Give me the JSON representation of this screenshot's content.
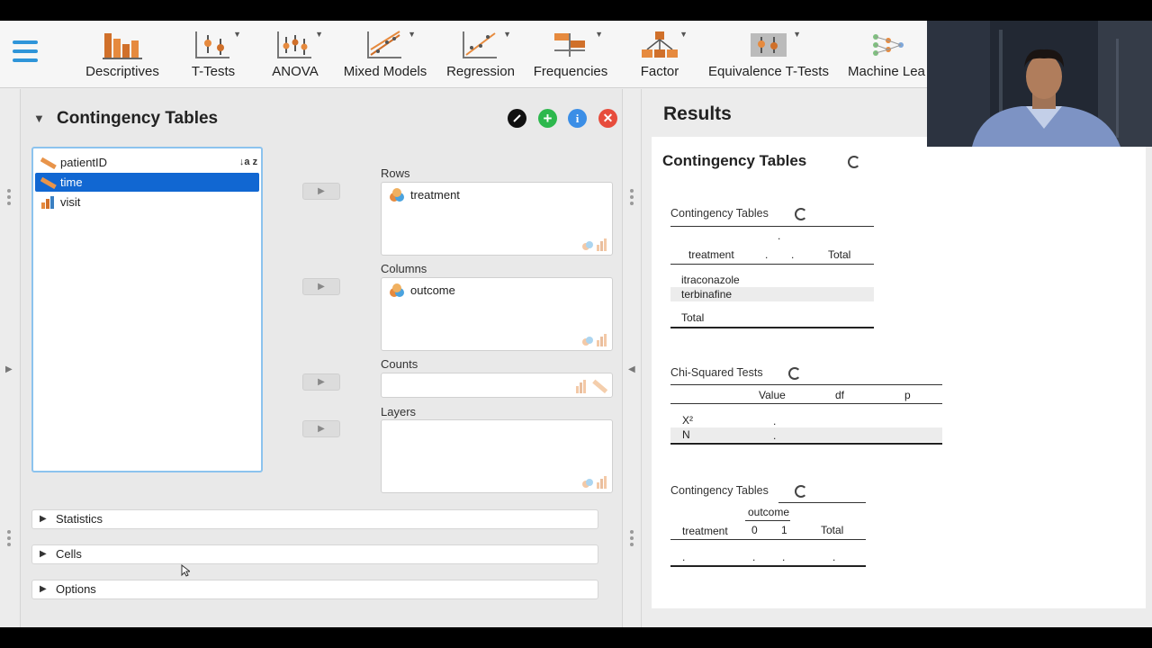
{
  "toolbar": {
    "modules": [
      {
        "label": "Descriptives"
      },
      {
        "label": "T-Tests"
      },
      {
        "label": "ANOVA"
      },
      {
        "label": "Mixed Models"
      },
      {
        "label": "Regression"
      },
      {
        "label": "Frequencies"
      },
      {
        "label": "Factor"
      },
      {
        "label": "Equivalence T-Tests"
      },
      {
        "label": "Machine Lea"
      }
    ]
  },
  "analysis": {
    "title": "Contingency Tables",
    "variables": [
      {
        "name": "patientID",
        "type": "nominal-text"
      },
      {
        "name": "time",
        "type": "nominal-text",
        "selected": true
      },
      {
        "name": "visit",
        "type": "scale"
      }
    ],
    "sort_label": "↓a z",
    "rows_label": "Rows",
    "rows_item": "treatment",
    "columns_label": "Columns",
    "columns_item": "outcome",
    "counts_label": "Counts",
    "layers_label": "Layers",
    "sections": [
      {
        "label": "Statistics"
      },
      {
        "label": "Cells"
      },
      {
        "label": "Options"
      }
    ]
  },
  "results": {
    "heading": "Results",
    "title": "Contingency Tables",
    "table1": {
      "title": "Contingency Tables",
      "top_dot": ".",
      "headers": [
        "treatment",
        ".",
        ".",
        "Total"
      ],
      "rows": [
        "itraconazole",
        "terbinafine",
        "Total"
      ]
    },
    "table2": {
      "title": "Chi-Squared Tests",
      "headers": [
        "Value",
        "df",
        "p"
      ],
      "rows": [
        {
          "label": "X²",
          "value": "."
        },
        {
          "label": "N",
          "value": "."
        }
      ]
    },
    "table3": {
      "title": "Contingency Tables",
      "group_header": "outcome",
      "headers": [
        "treatment",
        "0",
        "1",
        "Total"
      ],
      "row": [
        ".",
        ".",
        ".",
        "."
      ]
    }
  },
  "colors": {
    "accent": "#2f95d9",
    "selected": "#1167d2",
    "nominal": "#e8944a",
    "close": "#e74c3c",
    "add": "#2db84d",
    "info": "#3b8ee6"
  }
}
